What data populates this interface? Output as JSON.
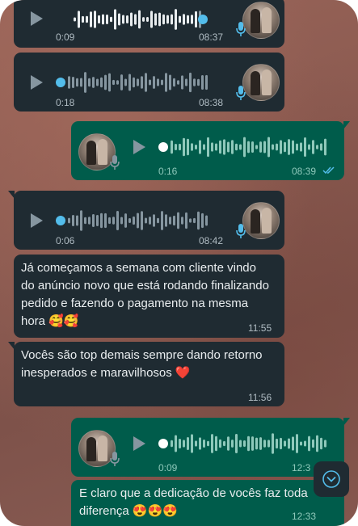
{
  "colors": {
    "incoming": "#1f2b32",
    "outgoing": "#005c4b",
    "accent_blue": "#53bdeb",
    "wave_played": "#e9edef",
    "wave_unplayed": "#8696a0"
  },
  "messages": [
    {
      "type": "audio",
      "direction": "incoming",
      "duration": "0:09",
      "time": "08:37",
      "progress": 0.93
    },
    {
      "type": "audio",
      "direction": "incoming",
      "duration": "0:18",
      "time": "08:38",
      "progress": 0.0
    },
    {
      "type": "audio",
      "direction": "outgoing",
      "duration": "0:16",
      "time": "08:39",
      "progress": 0.0,
      "status": "read"
    },
    {
      "type": "audio",
      "direction": "incoming",
      "duration": "0:06",
      "time": "08:42",
      "progress": 0.0
    },
    {
      "type": "text",
      "direction": "incoming",
      "text": "Já começamos a semana com cliente vindo do anúncio novo que está rodando finalizando pedido e fazendo o pagamento na mesma hora 🥰🥰",
      "time": "11:55"
    },
    {
      "type": "text",
      "direction": "incoming",
      "text": "Vocês são top demais sempre dando retorno inesperados e maravilhosos ❤️",
      "time": "11:56"
    },
    {
      "type": "audio",
      "direction": "outgoing",
      "duration": "0:09",
      "time": "12:3",
      "progress": 0.0
    },
    {
      "type": "text",
      "direction": "outgoing",
      "text": "E claro que a dedicação de vocês faz toda diferença 😍😍😍",
      "time": "12:33"
    }
  ],
  "icons": {
    "play": "play-icon",
    "mic": "mic-icon",
    "read": "double-check-icon",
    "scroll": "chevron-down-icon"
  }
}
